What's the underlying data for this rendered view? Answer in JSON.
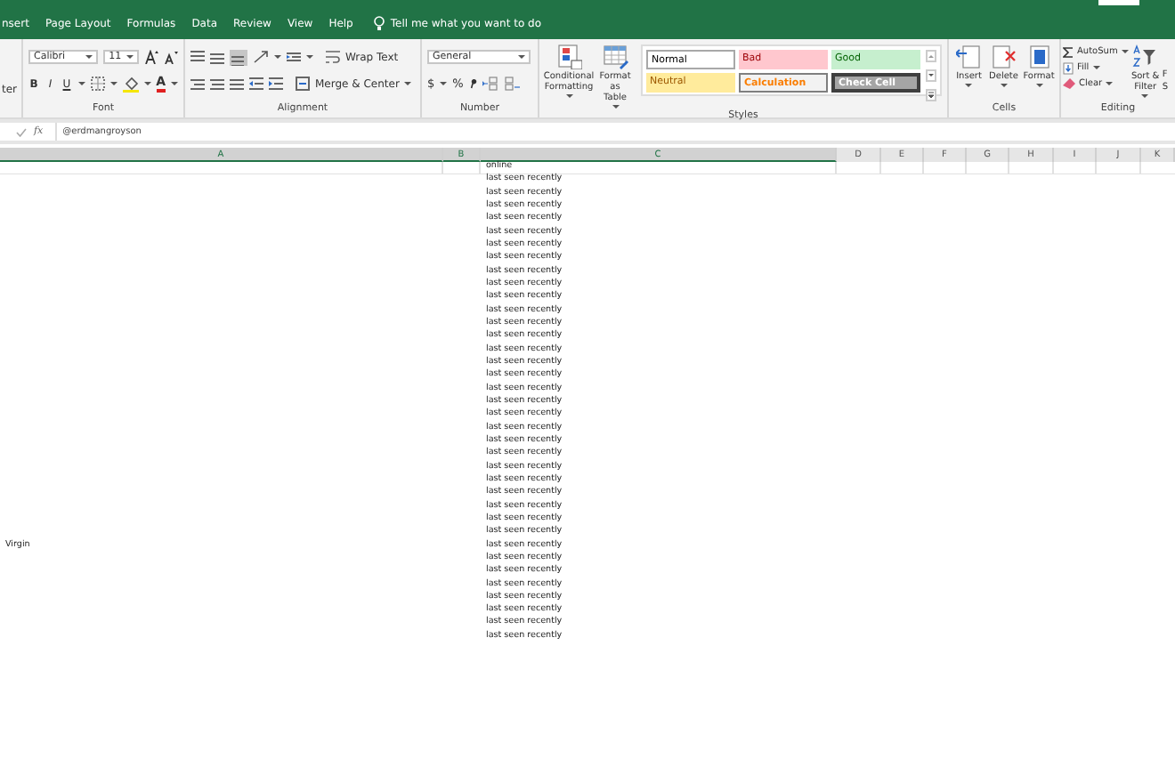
{
  "ribbon": {
    "tabs": [
      {
        "label": "nsert",
        "selected": false
      },
      {
        "label": "Page Layout",
        "selected": false
      },
      {
        "label": "Formulas",
        "selected": false
      },
      {
        "label": "Data",
        "selected": false
      },
      {
        "label": "Review",
        "selected": false
      },
      {
        "label": "View",
        "selected": false
      },
      {
        "label": "Help",
        "selected": false
      }
    ],
    "tell_me": "Tell me what you want to do",
    "groups": [
      {
        "kind": "clipboard",
        "label": "ter"
      },
      {
        "kind": "font",
        "label": "Font",
        "font": "Calibri",
        "size": "11",
        "format_buttons": [
          "B",
          "I",
          "U"
        ],
        "font_color": "A"
      },
      {
        "kind": "alignment",
        "label": "Alignment",
        "wrap": "Wrap Text",
        "merge": "Merge & Center"
      },
      {
        "kind": "number",
        "label": "Number",
        "format": "General",
        "symbols": [
          "$",
          "%"
        ]
      },
      {
        "kind": "styles",
        "label": "Styles",
        "conditional": "Conditional Formatting",
        "table": "Format as Table",
        "cell_styles": [
          {
            "label": "Normal",
            "kind": "normal"
          },
          {
            "label": "Bad",
            "kind": "bad"
          },
          {
            "label": "Good",
            "kind": "good"
          },
          {
            "label": "Neutral",
            "kind": "neutral"
          },
          {
            "label": "Calculation",
            "kind": "calculation"
          },
          {
            "label": "Check Cell",
            "kind": "check"
          }
        ]
      },
      {
        "kind": "cells",
        "label": "Cells",
        "buttons": [
          "Insert",
          "Delete",
          "Format"
        ]
      },
      {
        "kind": "editing",
        "label": "Editing",
        "autosum": "AutoSum",
        "fill": "Fill",
        "clear": "Clear",
        "sort": "Sort & Filter",
        "find_lines": [
          "F",
          "S"
        ]
      }
    ]
  },
  "formula_bar": {
    "fx": "fx",
    "value": "@erdmangroyson"
  },
  "sheet": {
    "columns": [
      {
        "label": "A",
        "selected": true
      },
      {
        "label": "B",
        "selected": true
      },
      {
        "label": "C",
        "selected": true
      },
      {
        "label": "D",
        "selected": false
      },
      {
        "label": "E",
        "selected": false
      },
      {
        "label": "F",
        "selected": false
      },
      {
        "label": "G",
        "selected": false
      },
      {
        "label": "H",
        "selected": false
      },
      {
        "label": "I",
        "selected": false
      },
      {
        "label": "J",
        "selected": false
      },
      {
        "label": "K",
        "selected": false
      }
    ],
    "rows": [
      {
        "C": "online"
      },
      {
        "C": "last seen recently"
      },
      {
        "C": "last seen recently"
      },
      {
        "C": "last seen recently"
      },
      {
        "C": "last seen recently"
      },
      {
        "C": "last seen recently"
      },
      {
        "C": "last seen recently"
      },
      {
        "C": "last seen recently"
      },
      {
        "C": "last seen recently"
      },
      {
        "C": "last seen recently"
      },
      {
        "C": "last seen recently"
      },
      {
        "C": "last seen recently"
      },
      {
        "C": "last seen recently"
      },
      {
        "C": "last seen recently"
      },
      {
        "C": "last seen recently"
      },
      {
        "C": "last seen recently"
      },
      {
        "C": "last seen recently"
      },
      {
        "C": "last seen recently"
      },
      {
        "C": "last seen recently"
      },
      {
        "C": "last seen recently"
      },
      {
        "C": "last seen recently"
      },
      {
        "C": "last seen recently"
      },
      {
        "C": "last seen recently"
      },
      {
        "C": "last seen recently"
      },
      {
        "C": "last seen recently"
      },
      {
        "C": "last seen recently"
      },
      {
        "C": "last seen recently"
      },
      {
        "C": "last seen recently"
      },
      {
        "C": "last seen recently"
      },
      {
        "A": "Virgin",
        "C": "last seen recently"
      },
      {
        "C": "last seen recently"
      },
      {
        "C": "last seen recently"
      },
      {
        "C": "last seen recently"
      },
      {
        "C": "last seen recently"
      },
      {
        "C": "last seen recently"
      },
      {
        "C": "last seen recently"
      },
      {
        "C": "last seen recently"
      }
    ]
  }
}
